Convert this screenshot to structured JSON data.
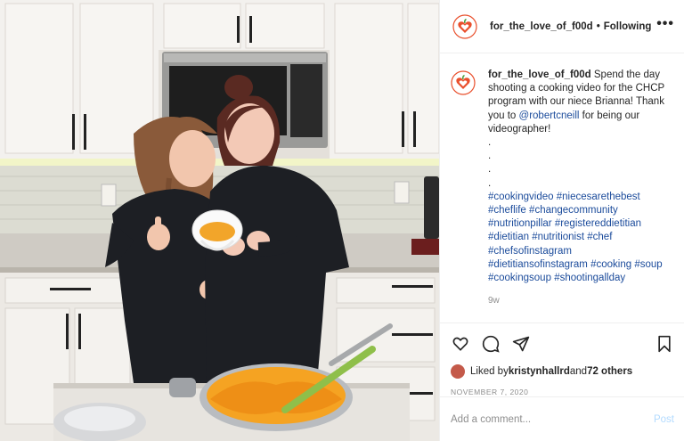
{
  "colors": {
    "accent": "#e94f2c",
    "link": "#1b4b9b",
    "muted": "#8e8e8e",
    "post_disabled": "#b3dbff"
  },
  "header": {
    "username": "for_the_love_of_f00d",
    "separator": "•",
    "follow_state": "Following",
    "more_icon": "ellipsis-icon"
  },
  "caption": {
    "username": "for_the_love_of_f00d",
    "text_before_mention": " Spend the day shooting a cooking video for the CHCP program with our niece Brianna! Thank you to ",
    "mention": "@robertcneill",
    "text_after_mention": " for being our videographer!",
    "dots": [
      ".",
      ".",
      ".",
      "."
    ],
    "hashtags": [
      "#cookingvideo",
      "#niecesarethebest",
      "#cheflife",
      "#changecommunity",
      "#nutritionpillar",
      "#registereddietitian",
      "#dietitian",
      "#nutritionist",
      "#chef",
      "#chefsofinstagram",
      "#dietitiansofinstagram",
      "#cooking",
      "#soup",
      "#cookingsoup",
      "#shootingallday"
    ],
    "time_ago": "9w"
  },
  "actions": {
    "like_icon": "heart-icon",
    "comment_icon": "comment-icon",
    "share_icon": "share-icon",
    "save_icon": "bookmark-icon"
  },
  "likes": {
    "prefix": "Liked by ",
    "user": "kristynhallrd",
    "middle": " and ",
    "others": "72 others"
  },
  "date": "NOVEMBER 7, 2020",
  "comment_box": {
    "placeholder": "Add a comment...",
    "post_label": "Post"
  }
}
